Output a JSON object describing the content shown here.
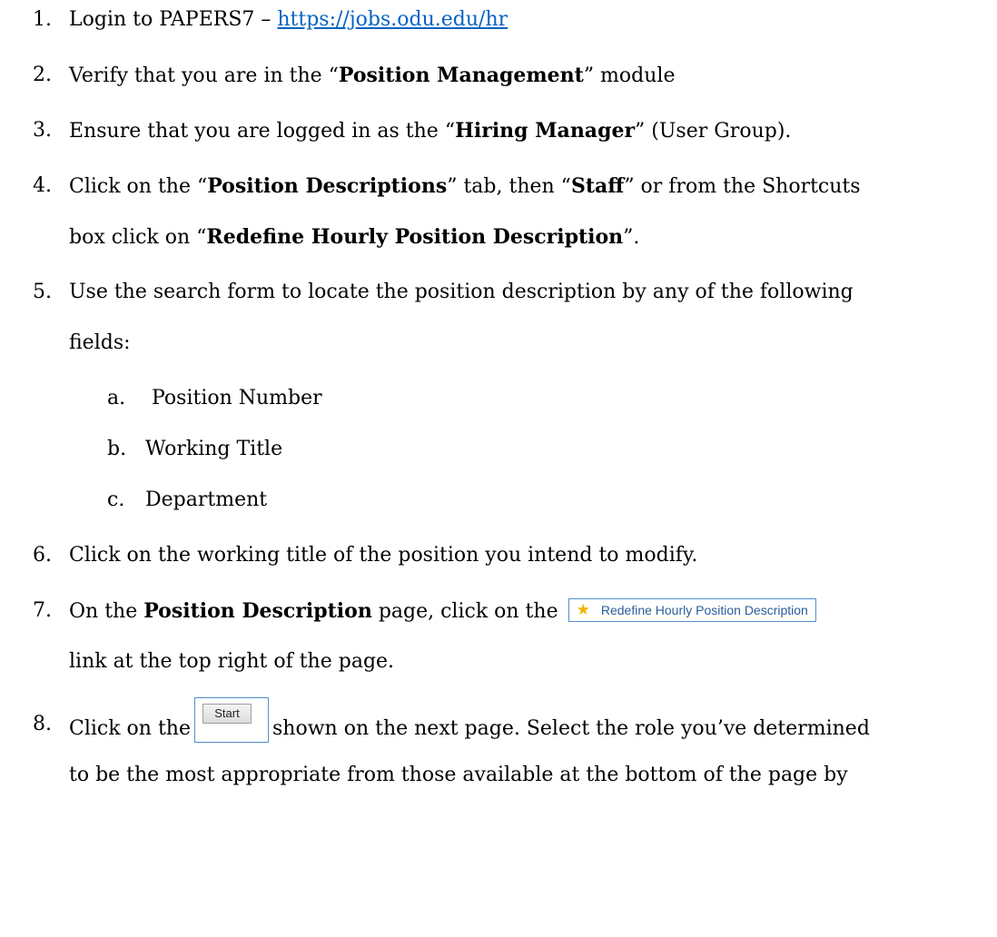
{
  "steps": [
    {
      "num": "1.",
      "pre": "Login to PAPERS7 – ",
      "link": "https://jobs.odu.edu/hr"
    },
    {
      "num": "2.",
      "pre": "Verify that you are in the “",
      "bold": "Position Management",
      "post": "” module"
    },
    {
      "num": "3.",
      "pre": "Ensure that you are logged in as the “",
      "bold": "Hiring Manager",
      "post": "” (User Group)."
    },
    {
      "num": "4.",
      "pre": "Click on the “",
      "bold1": "Position Descriptions",
      "mid": "” tab, then “",
      "bold2": "Staff",
      "post": "” or from the Shortcuts",
      "line2_pre": "box click on “",
      "line2_bold": "Redefine Hourly Position Description",
      "line2_post": "”."
    },
    {
      "num": "5.",
      "text": "Use the search form to locate the position description by any of the following",
      "line2": "fields:",
      "subitems": [
        {
          "letter": "a.",
          "text": " Position Number"
        },
        {
          "letter": "b.",
          "text": "Working Title"
        },
        {
          "letter": "c.",
          "text": "Department"
        }
      ]
    },
    {
      "num": "6.",
      "text": "Click on the working title of the position you intend to modify."
    },
    {
      "num": "7.",
      "pre": "On the ",
      "bold": "Position Description",
      "post": " page, click on the",
      "button_label": "Redefine Hourly Position Description",
      "button_icon": "star-icon",
      "line2": "link at the top right of the page."
    },
    {
      "num": "8.",
      "pre": "Click on the",
      "button_label": "Start",
      "post": "shown on the next page. Select the role you’ve determined",
      "line2": "to be the most appropriate from those available at the bottom of the page by"
    }
  ],
  "colors": {
    "link": "#0563c1",
    "button_border": "#4f90d0",
    "star": "#f0b400"
  }
}
